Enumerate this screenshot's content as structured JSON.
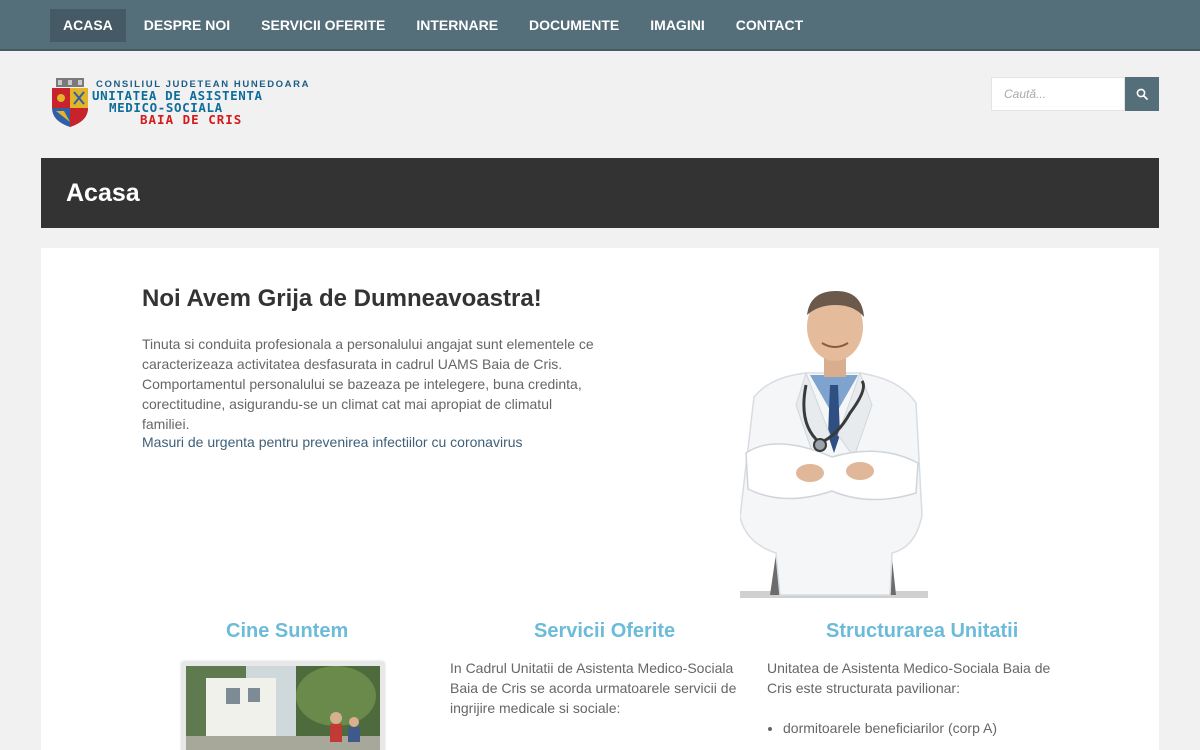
{
  "nav": {
    "items": [
      "ACASA",
      "DESPRE NOI",
      "SERVICII OFERITE",
      "INTERNARE",
      "DOCUMENTE",
      "IMAGINI",
      "CONTACT"
    ],
    "active": "ACASA"
  },
  "logo": {
    "line1": "CONSILIUL JUDETEAN HUNEDOARA",
    "line2": "UNITATEA DE ASISTENTA",
    "line3": "MEDICO-SOCIALA",
    "line4": "BAIA DE CRIS"
  },
  "search": {
    "placeholder": "Caută..."
  },
  "page": {
    "title": "Acasa"
  },
  "hero": {
    "title": "Noi Avem Grija de Dumneavoastra!",
    "text": "Tinuta si conduita profesionala a personalului angajat sunt elementele ce caracterizeaza activitatea desfasurata in cadrul UAMS Baia de Cris. Comportamentul personalului se bazeaza pe intelegere, buna credinta, corectitudine, asigurandu-se un climat cat mai apropiat de climatul familiei.",
    "link": "Masuri de urgenta pentru prevenirea infectiilor cu coronavirus"
  },
  "columns": [
    {
      "title": "Cine Suntem"
    },
    {
      "title": "Servicii Oferite",
      "text": "In Cadrul Unitatii de Asistenta Medico-Sociala Baia de Cris se acorda urmatoarele servicii de ingrijire medicale si sociale:"
    },
    {
      "title": "Structurarea Unitatii",
      "text": "Unitatea de Asistenta Medico-Sociala Baia de Cris este structurata pavilionar:",
      "list": [
        "dormitoarele beneficiarilor (corp A)"
      ]
    }
  ],
  "colors": {
    "nav": "#546e7a",
    "title_bar": "#333333",
    "accent": "#6bbbd9"
  }
}
